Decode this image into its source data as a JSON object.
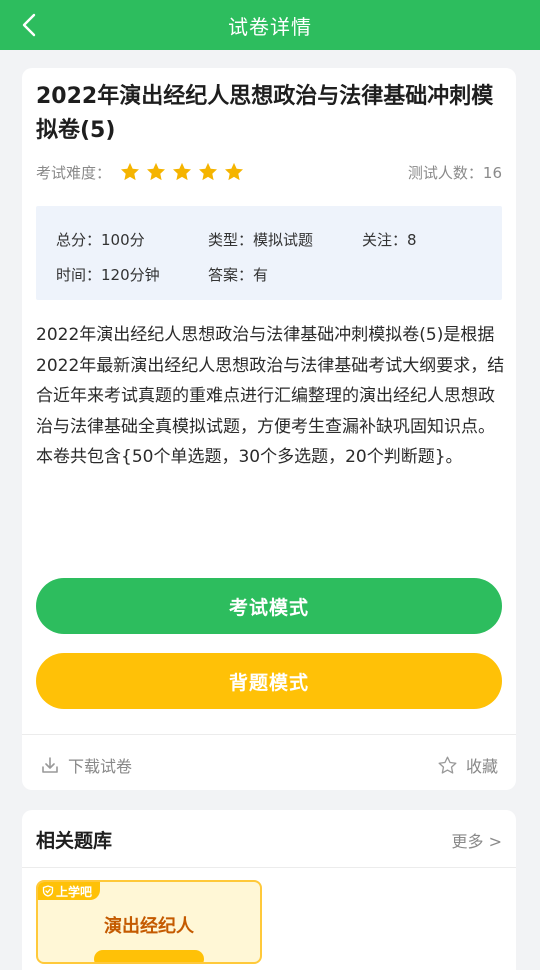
{
  "header": {
    "title": "试卷详情"
  },
  "paper": {
    "title": "2022年演出经纪人思想政治与法律基础冲刺模拟卷(5)",
    "difficulty_label": "考试难度：",
    "difficulty_stars": 5,
    "testers": "测试人数：16",
    "info": {
      "total_score": "总分：100分",
      "type": "类型：模拟试题",
      "follow": "关注：8",
      "time": "时间：120分钟",
      "answer": "答案：有"
    },
    "description": "2022年演出经纪人思想政治与法律基础冲刺模拟卷(5)是根据2022年最新演出经纪人思想政治与法律基础考试大纲要求，结合近年来考试真题的重难点进行汇编整理的演出经纪人思想政治与法律基础全真模拟试题，方便考生查漏补缺巩固知识点。本卷共包含{50个单选题，30个多选题，20个判断题}。"
  },
  "buttons": {
    "exam_mode": "考试模式",
    "study_mode": "背题模式"
  },
  "actions": {
    "download": "下载试卷",
    "favorite": "收藏"
  },
  "related": {
    "title": "相关题库",
    "more": "更多 >",
    "items": [
      {
        "brand": "上学吧",
        "name": "演出经纪人"
      }
    ]
  },
  "colors": {
    "primary": "#2dbd5e",
    "accent": "#ffc107",
    "star": "#f5b400"
  }
}
